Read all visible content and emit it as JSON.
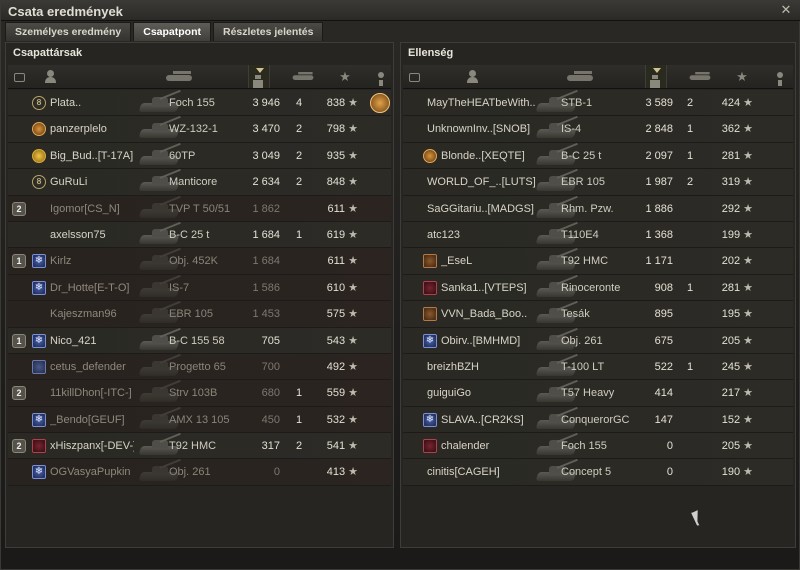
{
  "window": {
    "title": "Csata eredmények",
    "close_label": "✕"
  },
  "tabs": [
    {
      "label": "Személyes eredmény",
      "active": false
    },
    {
      "label": "Csapatpont",
      "active": true
    },
    {
      "label": "Részletes jelentés",
      "active": false
    }
  ],
  "left_team": {
    "title": "Csapattársak",
    "rows": [
      {
        "name": "Plata..",
        "tank": "Foch 155",
        "damage": "3 946",
        "kills": "4",
        "xp": "838",
        "alive": true,
        "self": true,
        "platoon": "",
        "badge": "rank",
        "rank": "8",
        "achievement": true
      },
      {
        "name": "panzerplelo",
        "tank": "WZ-132-1",
        "damage": "3 470",
        "kills": "2",
        "xp": "798",
        "alive": true,
        "platoon": "",
        "badge": "medal"
      },
      {
        "name": "Big_Bud..[T-17A]",
        "tank": "60TP",
        "damage": "3 049",
        "kills": "2",
        "xp": "935",
        "alive": true,
        "platoon": "",
        "badge": "gold"
      },
      {
        "name": "GuRuLi",
        "tank": "Manticore",
        "damage": "2 634",
        "kills": "2",
        "xp": "848",
        "alive": true,
        "platoon": "",
        "badge": "rank",
        "rank": "8"
      },
      {
        "name": "Igomor[CS_N]",
        "tank": "TVP T 50/51",
        "damage": "1 862",
        "kills": "",
        "xp": "611",
        "alive": false,
        "platoon": "2",
        "badge": ""
      },
      {
        "name": "axelsson75",
        "tank": "B-C 25 t",
        "damage": "1 684",
        "kills": "1",
        "xp": "619",
        "alive": true,
        "platoon": "",
        "badge": ""
      },
      {
        "name": "Kirlz",
        "tank": "Obj. 452K",
        "damage": "1 684",
        "kills": "",
        "xp": "611",
        "alive": false,
        "platoon": "1",
        "badge": "snow"
      },
      {
        "name": "Dr_Hotte[E-T-O]",
        "tank": "IS-7",
        "damage": "1 586",
        "kills": "",
        "xp": "610",
        "alive": false,
        "platoon": "",
        "badge": "snow"
      },
      {
        "name": "Kajeszman96",
        "tank": "EBR 105",
        "damage": "1 453",
        "kills": "",
        "xp": "575",
        "alive": false,
        "platoon": "",
        "badge": ""
      },
      {
        "name": "Nico_421",
        "tank": "B-C 155 58",
        "damage": "705",
        "kills": "",
        "xp": "543",
        "alive": true,
        "platoon": "1",
        "badge": "snow"
      },
      {
        "name": "cetus_defender",
        "tank": "Progetto 65",
        "damage": "700",
        "kills": "",
        "xp": "492",
        "alive": false,
        "platoon": "",
        "badge": "clan"
      },
      {
        "name": "11killDhon[-ITC-]",
        "tank": "Strv 103B",
        "damage": "680",
        "kills": "1",
        "xp": "559",
        "alive": false,
        "platoon": "2",
        "badge": ""
      },
      {
        "name": "_Bendo[GEUF]",
        "tank": "AMX 13 105",
        "damage": "450",
        "kills": "1",
        "xp": "532",
        "alive": false,
        "platoon": "",
        "badge": "snow"
      },
      {
        "name": "xHiszpanx[-DEV-]",
        "tank": "T92 HMC",
        "damage": "317",
        "kills": "2",
        "xp": "541",
        "alive": true,
        "platoon": "2",
        "badge": "clan3"
      },
      {
        "name": "OGVasyaPupkin",
        "tank": "Obj. 261",
        "damage": "0",
        "kills": "",
        "xp": "413",
        "alive": false,
        "platoon": "",
        "badge": "snow"
      }
    ]
  },
  "right_team": {
    "title": "Ellenség",
    "rows": [
      {
        "name": "MayTheHEATbeWith..",
        "tank": "STB-1",
        "damage": "3 589",
        "kills": "2",
        "xp": "424",
        "badge": ""
      },
      {
        "name": "UnknownInv..[SNOB]",
        "tank": "IS-4",
        "damage": "2 848",
        "kills": "1",
        "xp": "362",
        "badge": ""
      },
      {
        "name": "Blonde..[XEQTE]",
        "tank": "B-C 25 t",
        "damage": "2 097",
        "kills": "1",
        "xp": "281",
        "badge": "medal"
      },
      {
        "name": "WORLD_OF_..[LUTS]",
        "tank": "EBR 105",
        "damage": "1 987",
        "kills": "2",
        "xp": "319",
        "badge": ""
      },
      {
        "name": "SaGGitariu..[MADGS]",
        "tank": "Rhm. Pzw.",
        "damage": "1 886",
        "kills": "",
        "xp": "292",
        "badge": ""
      },
      {
        "name": "atc123",
        "tank": "T110E4",
        "damage": "1 368",
        "kills": "",
        "xp": "199",
        "badge": ""
      },
      {
        "name": "_EseL",
        "tank": "T92 HMC",
        "damage": "1 171",
        "kills": "",
        "xp": "202",
        "badge": "clan2"
      },
      {
        "name": "Sanka1..[VTEPS]",
        "tank": "Rinoceronte",
        "damage": "908",
        "kills": "1",
        "xp": "281",
        "badge": "clan3"
      },
      {
        "name": "VVN_Bada_Boo..",
        "tank": "Tesák",
        "damage": "895",
        "kills": "",
        "xp": "195",
        "badge": "clan2"
      },
      {
        "name": "Obirv..[BMHMD]",
        "tank": "Obj. 261",
        "damage": "675",
        "kills": "",
        "xp": "205",
        "badge": "snow"
      },
      {
        "name": "breizhBZH",
        "tank": "T-100 LT",
        "damage": "522",
        "kills": "1",
        "xp": "245",
        "badge": ""
      },
      {
        "name": "guiguiGo",
        "tank": "T57 Heavy",
        "damage": "414",
        "kills": "",
        "xp": "217",
        "badge": ""
      },
      {
        "name": "SLAVA..[CR2KS]",
        "tank": "ConquerorGC",
        "damage": "147",
        "kills": "",
        "xp": "152",
        "badge": "snow"
      },
      {
        "name": "chalender",
        "tank": "Foch 155",
        "damage": "0",
        "kills": "",
        "xp": "205",
        "badge": "clan3"
      },
      {
        "name": "cinitis[CAGEH]",
        "tank": "Concept 5",
        "damage": "0",
        "kills": "",
        "xp": "190",
        "badge": ""
      }
    ]
  },
  "icons": {
    "star": "★",
    "header": [
      "platoon-icon",
      "player-icon",
      "tank-icon",
      "damage-icon",
      "kills-icon",
      "xp-star-icon",
      "achievement-icon"
    ]
  }
}
